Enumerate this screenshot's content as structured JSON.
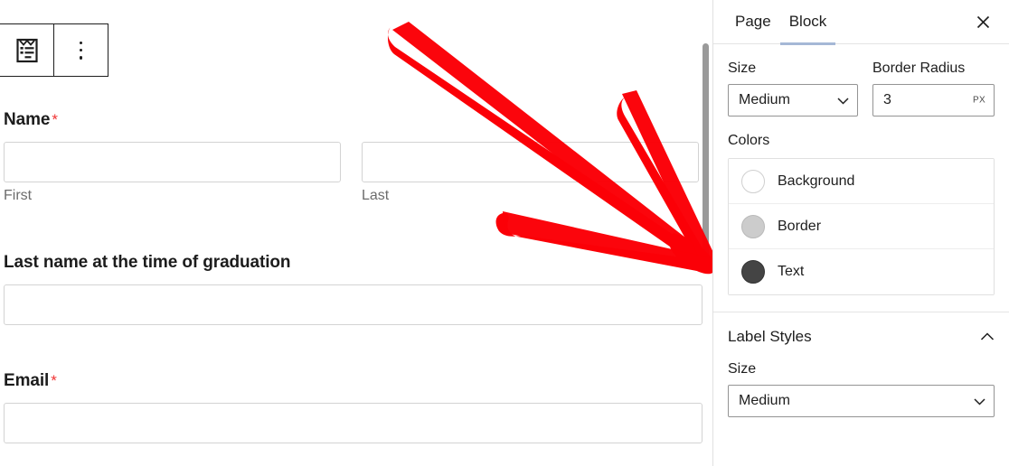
{
  "editor": {
    "toolbar": {
      "block_icon": "form-block-icon",
      "options_icon": "more-options-vertical-dots-icon"
    },
    "fields": [
      {
        "label": "Name",
        "required_marker": "*",
        "required": true,
        "subfields": [
          {
            "sub_label": "First",
            "value": ""
          },
          {
            "sub_label": "Last",
            "value": ""
          }
        ]
      },
      {
        "label": "Last name at the time of graduation",
        "required_marker": "",
        "required": false,
        "value": ""
      },
      {
        "label": "Email",
        "required_marker": "*",
        "required": true,
        "value": ""
      }
    ],
    "annotation": {
      "type": "hand-drawn-arrow",
      "color": "#fb0007",
      "points_to": "border-color-swatch-row"
    }
  },
  "sidebar": {
    "tabs": [
      {
        "label": "Page",
        "active": false
      },
      {
        "label": "Block",
        "active": true
      }
    ],
    "active_tab_underline_color": "#a5b8d6",
    "close_icon": "close-icon",
    "field_styles": {
      "size": {
        "label": "Size",
        "value": "Medium",
        "chevron": "chevron-down-icon"
      },
      "border_radius": {
        "label": "Border Radius",
        "value": "3",
        "unit": "PX"
      },
      "colors": {
        "title": "Colors",
        "items": [
          {
            "name": "Background",
            "color": "#ffffff",
            "swatch_border": "#cfcfcf"
          },
          {
            "name": "Border",
            "color": "#cccccc",
            "swatch_border": "#b9b9b9"
          },
          {
            "name": "Text",
            "color": "#444444",
            "swatch_border": "#333333"
          }
        ]
      }
    },
    "label_styles": {
      "title": "Label Styles",
      "collapse_icon": "chevron-up-icon",
      "expanded": true,
      "size": {
        "label": "Size",
        "value": "Medium",
        "chevron": "chevron-down-icon"
      }
    }
  }
}
